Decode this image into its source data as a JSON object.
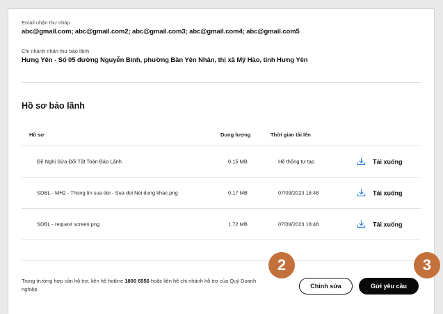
{
  "email_section": {
    "label": "Email nhận thư nháp",
    "value": "abc@gmail.com; abc@gmail.com2; abc@gmail.com3; abc@gmail.com4; abc@gmail.com5"
  },
  "branch_section": {
    "label": "Chi nhánh nhận thư bảo lãnh",
    "value": "Hưng Yên - Số 05 đường Nguyễn Bình, phường Bần Yên Nhân, thị xã Mỹ Hào, tỉnh Hưng Yên"
  },
  "documents": {
    "title": "Hồ sơ bảo lãnh",
    "columns": {
      "file": "Hồ sơ",
      "size": "Dung lượng",
      "uploaded": "Thời gian tải lên"
    },
    "rows": [
      {
        "name": "Đề Nghị Sửa Đổi Tất Toán Bảo Lãnh",
        "size": "0.15 MB",
        "uploaded": "Hệ thống tự tạo",
        "action": "Tải xuống"
      },
      {
        "name": "SDBL - MH2 - Thong tin sua doi - Sua doi Noi dung khac.png",
        "size": "0.17 MB",
        "uploaded": "07/09/2023 18:48",
        "action": "Tải xuống"
      },
      {
        "name": "SDBL - request screen.png",
        "size": "1.72 MB",
        "uploaded": "07/09/2023 18:48",
        "action": "Tải xuống"
      }
    ],
    "download_icon": "download-icon"
  },
  "footer": {
    "note_prefix": "Trong trường hợp cần hỗ trợ, liên hệ hotline ",
    "hotline": "1800 6556",
    "note_suffix": " hoặc liên hệ chi nhánh hỗ trợ của Quý Doanh nghiệp"
  },
  "actions": {
    "edit_label": "Chỉnh sửa",
    "send_label": "Gửi yêu cầu"
  },
  "badges": {
    "edit": "2",
    "send": "3",
    "color": "#c4703a"
  }
}
